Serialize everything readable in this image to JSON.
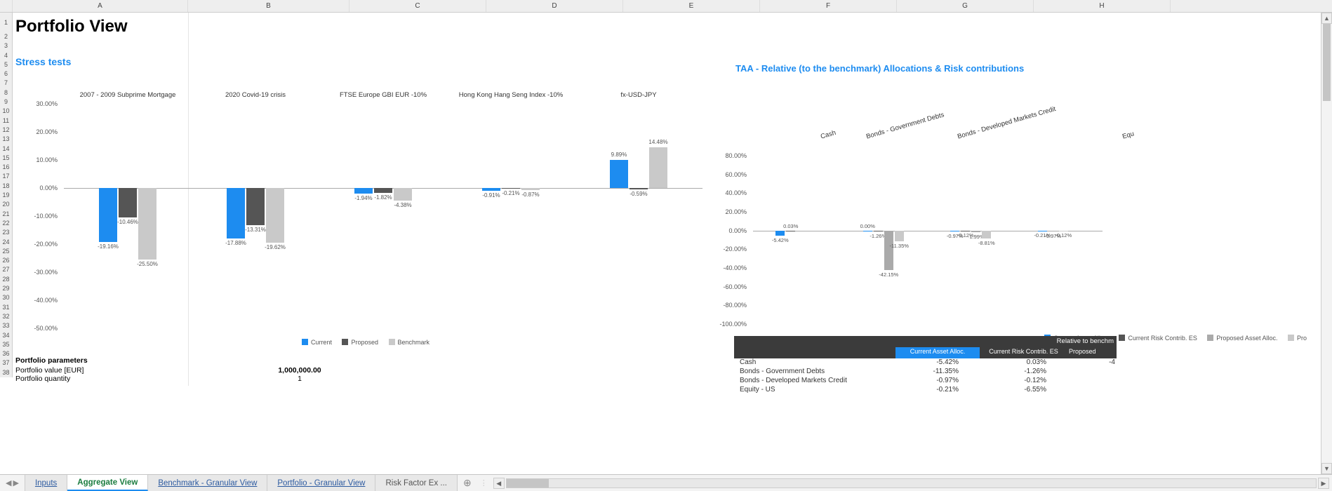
{
  "columns": [
    "A",
    "B",
    "C",
    "D",
    "E",
    "F",
    "G",
    "H"
  ],
  "row_count": 38,
  "title": "Portfolio View",
  "stress_label": "Stress tests",
  "taa_label": "TAA - Relative (to the benchmark) Allocations & Risk contributions",
  "chart_data": [
    {
      "type": "bar",
      "title": "",
      "xlabel": "",
      "ylabel": "",
      "ylim": [
        -50,
        30
      ],
      "yticks": [
        "30.00%",
        "20.00%",
        "10.00%",
        "0.00%",
        "-10.00%",
        "-20.00%",
        "-30.00%",
        "-40.00%",
        "-50.00%"
      ],
      "categories": [
        "2007 - 2009 Subprime Mortgage",
        "2020 Covid-19 crisis",
        "FTSE Europe GBI EUR -10%",
        "Hong Kong Hang Seng Index -10%",
        "fx-USD-JPY"
      ],
      "series": [
        {
          "name": "Current",
          "color": "#1d8cf0",
          "values": [
            -19.16,
            -17.88,
            -1.94,
            -0.91,
            9.89
          ]
        },
        {
          "name": "Proposed",
          "color": "#555555",
          "values": [
            -10.46,
            -13.31,
            -1.82,
            -0.21,
            -0.59
          ]
        },
        {
          "name": "Benchmark",
          "color": "#c9c9c9",
          "values": [
            -25.5,
            -19.62,
            -4.38,
            -0.87,
            14.48
          ]
        }
      ],
      "legend": [
        "Current",
        "Proposed",
        "Benchmark"
      ]
    },
    {
      "type": "bar",
      "title": "",
      "xlabel": "",
      "ylabel": "",
      "ylim": [
        -100,
        80
      ],
      "yticks": [
        "80.00%",
        "60.00%",
        "40.00%",
        "20.00%",
        "0.00%",
        "-20.00%",
        "-40.00%",
        "-60.00%",
        "-80.00%",
        "-100.00%"
      ],
      "categories": [
        "Cash",
        "Bonds - Government Debts",
        "Bonds - Developed Markets Credit",
        "Equ"
      ],
      "series": [
        {
          "name": "Current Asset Alloc.",
          "color": "#1d8cf0",
          "values": [
            -5.42,
            0.0,
            -0.97,
            -0.21
          ]
        },
        {
          "name": "Current Risk Contrib. ES",
          "color": "#555555",
          "values": [
            0.03,
            -1.26,
            -0.12,
            null
          ]
        },
        {
          "name": "Proposed Asset Alloc.",
          "color": "#aaaaaa",
          "values": [
            null,
            -42.15,
            -1.99,
            -0.97
          ]
        },
        {
          "name": "Pro",
          "color": "#c9c9c9",
          "values": [
            null,
            -11.35,
            -8.81,
            -0.12
          ]
        }
      ],
      "legend": [
        "Current Asset Alloc.",
        "Current Risk Contrib. ES",
        "Proposed Asset Alloc.",
        "Pro"
      ]
    }
  ],
  "params": {
    "header": "Portfolio parameters",
    "rows": [
      {
        "k": "Portfolio value  [EUR]",
        "v": "1,000,000.00",
        "bold": true
      },
      {
        "k": "Portfolio quantity",
        "v": "1",
        "bold": false
      }
    ]
  },
  "rtable": {
    "superheader": "Relative to benchm",
    "cols": [
      "",
      "Current Asset Alloc.",
      "Current Risk Contrib. ES",
      "Proposed"
    ],
    "rows": [
      {
        "n": "Cash",
        "a": "-5.42%",
        "b": "0.03%",
        "c": "-4"
      },
      {
        "n": "Bonds - Government Debts",
        "a": "-11.35%",
        "b": "-1.26%",
        "c": ""
      },
      {
        "n": "Bonds - Developed Markets Credit",
        "a": "-0.97%",
        "b": "-0.12%",
        "c": ""
      },
      {
        "n": "Equity - US",
        "a": "-0.21%",
        "b": "-6.55%",
        "c": ""
      }
    ]
  },
  "tabs": {
    "items": [
      "Inputs",
      "Aggregate View",
      "Benchmark - Granular View",
      "Portfolio - Granular View",
      "Risk Factor Ex ..."
    ],
    "active": 1
  }
}
